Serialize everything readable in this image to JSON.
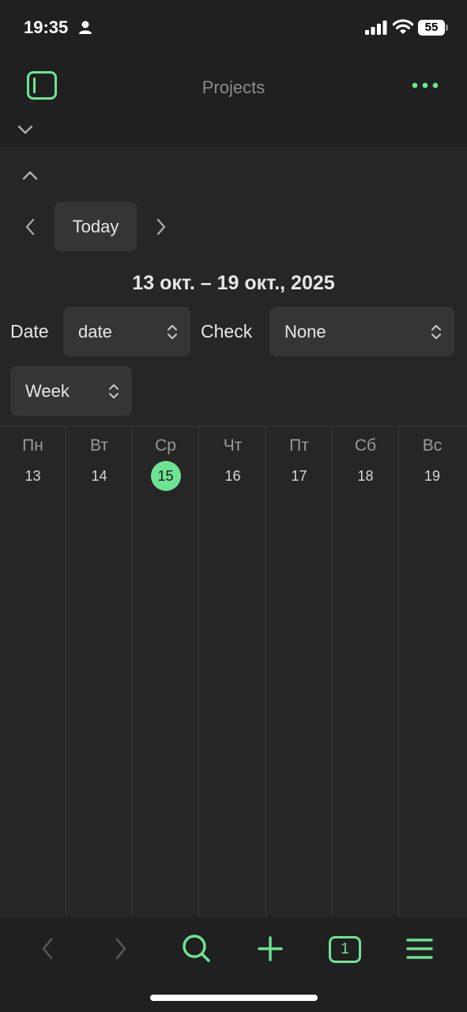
{
  "status": {
    "time": "19:35",
    "battery": "55"
  },
  "header": {
    "title": "Projects"
  },
  "nav": {
    "today_label": "Today",
    "range": "13 окт. – 19 окт., 2025"
  },
  "filters": {
    "date_label": "Date",
    "date_value": "date",
    "check_label": "Check",
    "check_value": "None",
    "view_value": "Week"
  },
  "calendar": {
    "days": [
      {
        "name": "Пн",
        "num": "13"
      },
      {
        "name": "Вт",
        "num": "14"
      },
      {
        "name": "Ср",
        "num": "15"
      },
      {
        "name": "Чт",
        "num": "16"
      },
      {
        "name": "Пт",
        "num": "17"
      },
      {
        "name": "Сб",
        "num": "18"
      },
      {
        "name": "Вс",
        "num": "19"
      }
    ]
  },
  "toolbar": {
    "tabs_count": "1"
  },
  "colors": {
    "accent": "#6fe394",
    "background": "#262626",
    "bar": "#202020",
    "control": "#353535"
  }
}
